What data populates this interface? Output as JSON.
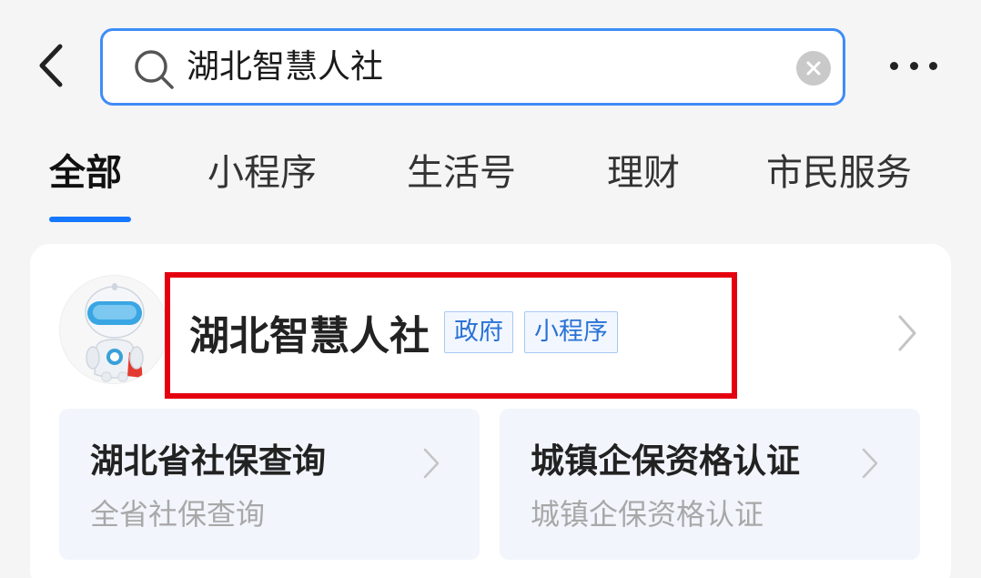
{
  "search": {
    "query": "湖北智慧人社"
  },
  "tabs": [
    {
      "label": "全部"
    },
    {
      "label": "小程序"
    },
    {
      "label": "生活号"
    },
    {
      "label": "理财"
    },
    {
      "label": "市民服务"
    }
  ],
  "result": {
    "title": "湖北智慧人社",
    "tags": [
      "政府",
      "小程序"
    ],
    "services": [
      {
        "title": "湖北省社保查询",
        "desc": "全省社保查询"
      },
      {
        "title": "城镇企保资格认证",
        "desc": "城镇企保资格认证"
      }
    ]
  },
  "colors": {
    "accent": "#1677ff",
    "search_border": "#3f8cf6",
    "highlight": "#e5000f",
    "tag_text": "#2a72d6"
  },
  "icons": [
    "back-arrow-icon",
    "search-icon",
    "clear-icon",
    "more-icon",
    "robot-avatar-icon",
    "chevron-right-icon"
  ]
}
